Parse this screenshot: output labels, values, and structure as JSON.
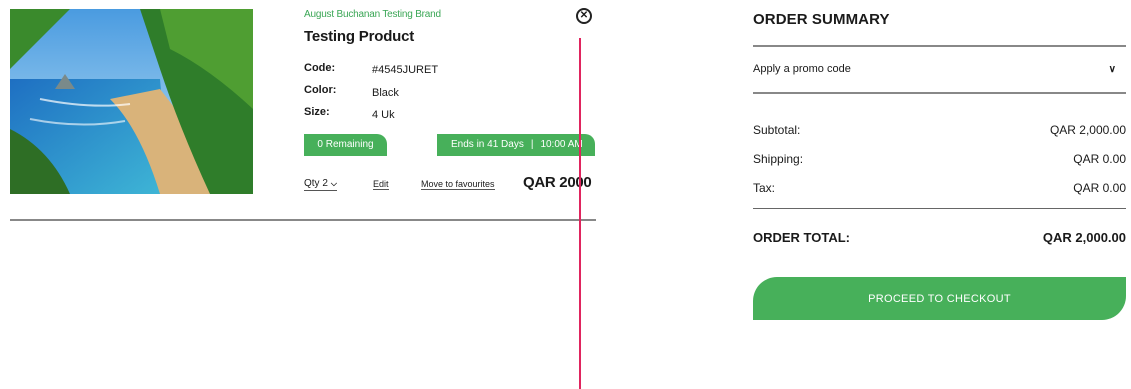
{
  "cart_item": {
    "brand": "August Buchanan Testing Brand",
    "title": "Testing Product",
    "specs": [
      {
        "label": "Code:",
        "value": "#4545JURET"
      },
      {
        "label": "Color:",
        "value": "Black"
      },
      {
        "label": "Size:",
        "value": "4 Uk"
      }
    ],
    "remaining": "0 Remaining",
    "ends_in": "Ends in 41 Days",
    "ends_time": "10:00 AM",
    "qty_label": "Qty 2",
    "edit_label": "Edit",
    "fav_label": "Move to favourites",
    "price": "QAR 2000"
  },
  "summary": {
    "title": "ORDER SUMMARY",
    "promo_label": "Apply a promo code",
    "subtotal_label": "Subtotal:",
    "subtotal_value": "QAR 2,000.00",
    "shipping_label": "Shipping:",
    "shipping_value": "QAR 0.00",
    "tax_label": "Tax:",
    "tax_value": "QAR 0.00",
    "total_label": "ORDER TOTAL:",
    "total_value": "QAR 2,000.00",
    "checkout_label": "PROCEED TO CHECKOUT"
  },
  "icons": {
    "remove": "close-circle-icon",
    "chevron": "chevron-down-icon"
  },
  "colors": {
    "accent_green": "#47b05a",
    "brand_green": "#3aa655",
    "marker_red": "#e0245e"
  }
}
